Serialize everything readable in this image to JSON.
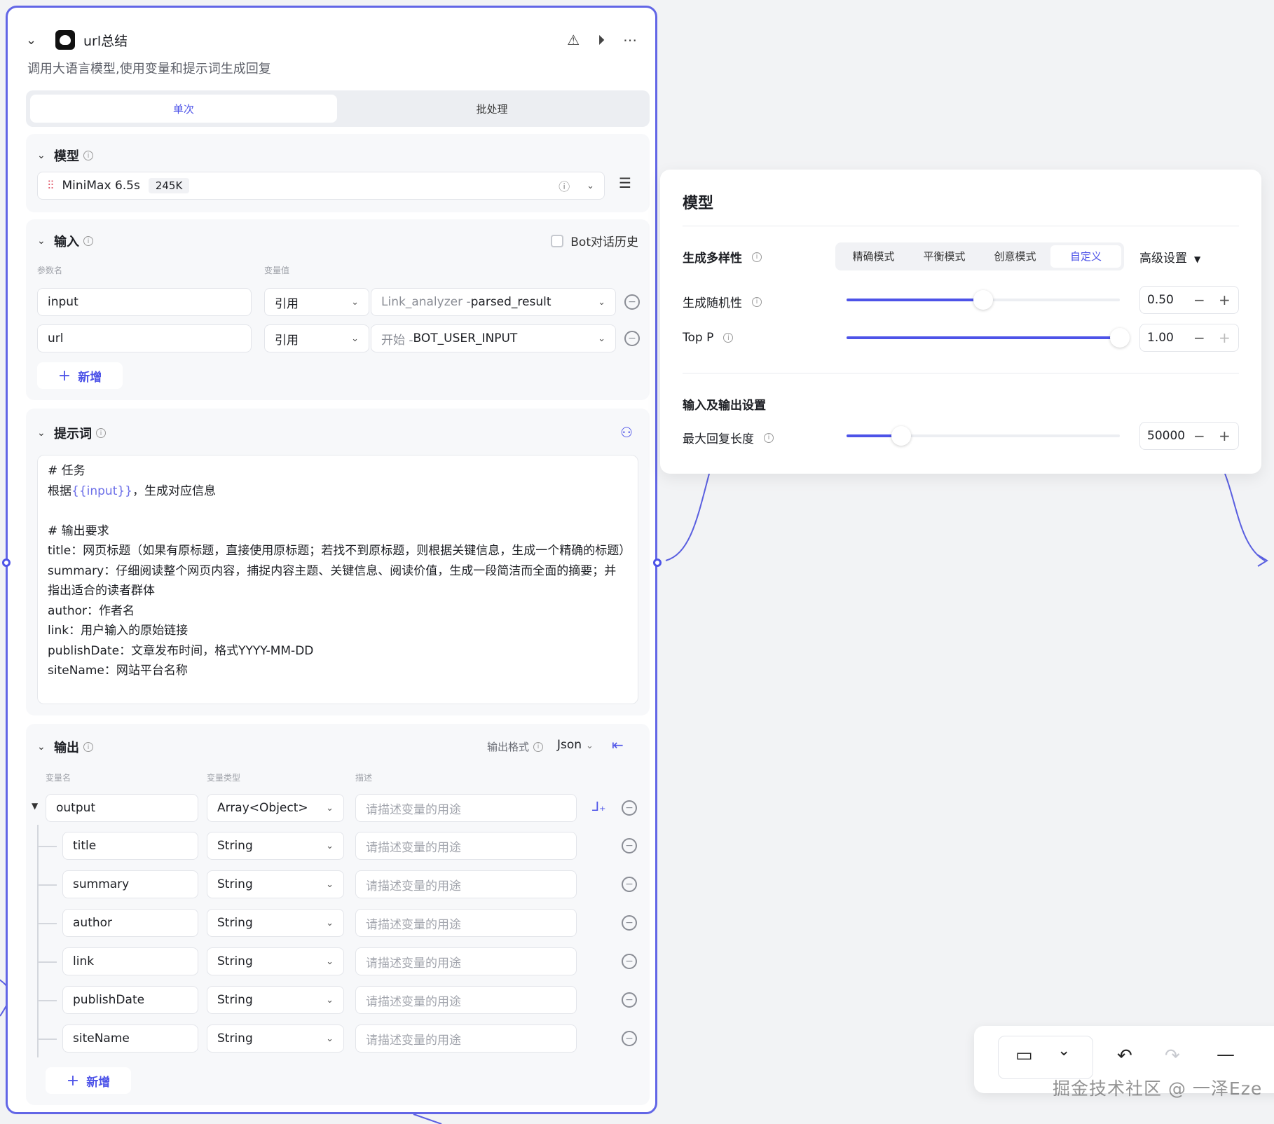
{
  "node": {
    "title": "url总结",
    "description": "调用大语言模型,使用变量和提示词生成回复",
    "header_icons": [
      "debug-off-icon",
      "play-icon",
      "more-icon"
    ],
    "tabs": {
      "single": "单次",
      "batch": "批处理"
    }
  },
  "model_section": {
    "title": "模型",
    "model_name": "MiniMax 6.5s",
    "context_badge": "245K"
  },
  "input_section": {
    "title": "输入",
    "history_label": "Bot对话历史",
    "history_checked": false,
    "col_name": "参数名",
    "col_value": "变量值",
    "rows": [
      {
        "name": "input",
        "type": "引用",
        "source_prefix": "Link_analyzer - ",
        "source": "parsed_result"
      },
      {
        "name": "url",
        "type": "引用",
        "source_prefix": "开始 - ",
        "source": "BOT_USER_INPUT"
      }
    ],
    "add_label": "新增"
  },
  "prompt_section": {
    "title": "提示词",
    "lines": [
      "# 任务",
      "根据{{input}}，生成对应信息",
      "",
      "# 输出要求",
      "title：网页标题（如果有原标题，直接使用原标题；若找不到原标题，则根据关键信息，生成一个精确的标题）",
      "summary：仔细阅读整个网页内容，捕捉内容主题、关键信息、阅读价值，生成一段简洁而全面的摘要；并指出适合的读者群体",
      "author：作者名",
      "link：用户输入的原始链接",
      "publishDate：文章发布时间，格式YYYY-MM-DD",
      "siteName：网站平台名称"
    ]
  },
  "output_section": {
    "title": "输出",
    "format_label": "输出格式",
    "format_value": "Json",
    "col_name": "变量名",
    "col_type": "变量类型",
    "col_desc": "描述",
    "desc_placeholder": "请描述变量的用途",
    "root": {
      "name": "output",
      "type": "Array<Object>"
    },
    "children": [
      {
        "name": "title",
        "type": "String"
      },
      {
        "name": "summary",
        "type": "String"
      },
      {
        "name": "author",
        "type": "String"
      },
      {
        "name": "link",
        "type": "String"
      },
      {
        "name": "publishDate",
        "type": "String"
      },
      {
        "name": "siteName",
        "type": "String"
      }
    ],
    "add_label": "新增"
  },
  "model_panel": {
    "title": "模型",
    "diversity_label": "生成多样性",
    "modes": [
      "精确模式",
      "平衡模式",
      "创意模式",
      "自定义"
    ],
    "active_mode": "自定义",
    "advanced_label": "高级设置",
    "temperature": {
      "label": "生成随机性",
      "value": "0.50",
      "fraction": 0.5
    },
    "top_p": {
      "label": "Top P",
      "value": "1.00",
      "fraction": 1.0
    },
    "io_title": "输入及输出设置",
    "max_tokens": {
      "label": "最大回复长度",
      "value": "50000",
      "fraction": 0.2
    }
  },
  "toolbar": {
    "icons": [
      "minimap-icon",
      "chevron-down-icon",
      "undo-icon",
      "redo-icon",
      "zoom-out-icon"
    ]
  },
  "watermark": "掘金技术社区 @ 一泽Eze",
  "colors": {
    "accent": "#4d53e8",
    "node_border": "#6266e6",
    "canvas": "#f2f3f5"
  }
}
